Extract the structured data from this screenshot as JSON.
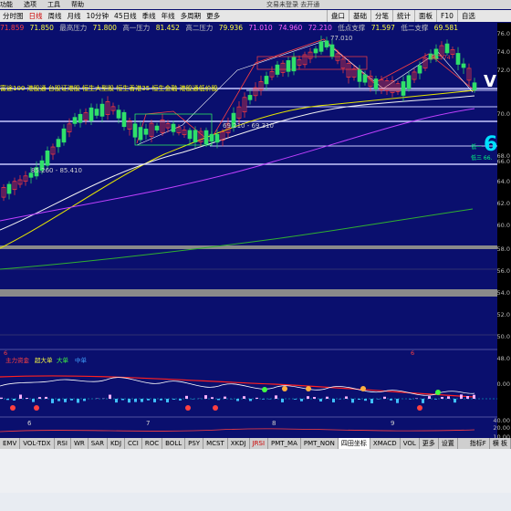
{
  "menubar": {
    "items": [
      "功能",
      "选项",
      "工具",
      "帮助"
    ],
    "center_text": "交易未登录 去开通"
  },
  "periods": [
    "分时图",
    "日线",
    "周线",
    "月线",
    "10分钟",
    "45日线",
    "季线",
    "年线",
    "多周期",
    "更多"
  ],
  "selected_period": "日线",
  "right_tools": [
    "盘口",
    "基础",
    "分笔",
    "统计",
    "面板",
    "F10",
    "自选"
  ],
  "info": {
    "prices": [
      "71.859",
      "71.850",
      "71.800",
      "81.452",
      "79.936",
      "71.010",
      "74.960",
      "72.210",
      "71.597",
      "69.581"
    ],
    "labels": [
      "最高压力",
      "高一压力",
      "高二压力",
      "低点支撑",
      "低二支撑"
    ]
  },
  "sector_text": "富途100 港股通 台股证港股 恒生大型股 恒生香港35 恒生金融 港股通低价股",
  "annotations": {
    "range1": "85.260 - 85.410",
    "range2": "69.210 - 69.310",
    "high_mark": "77.010",
    "big_price": "69",
    "v_mark": "V",
    "label_low1": "低一",
    "label_low3": "低三 66.",
    "label_high2": "高二 74"
  },
  "y_ticks": [
    "76.0",
    "74.0",
    "72.0",
    "70.0",
    "68.0",
    "66.0",
    "64.0",
    "62.0",
    "60.0",
    "58.0",
    "56.0",
    "54.0",
    "52.0",
    "50.0",
    "48.0",
    "46.0"
  ],
  "ind_ticks": [
    "0.00",
    "40.00",
    "20.00",
    "10.00"
  ],
  "date_ticks": [
    "6",
    "7",
    "8",
    "9"
  ],
  "indicator_legend": [
    "主力资金",
    "超大单",
    "大单",
    "中单"
  ],
  "tabs": [
    "EMV",
    "VOL-TDX",
    "RSI",
    "WR",
    "SAR",
    "KDJ",
    "CCI",
    "ROC",
    "BOLL",
    "PSY",
    "MCST",
    "XKDJ",
    "JRSI",
    "PMT_MA",
    "PMT_NON",
    "四田坐标",
    "XMACD",
    "VOL",
    "更多",
    "设置"
  ],
  "tab_selected": "四田坐标",
  "tab_red": "JRSI",
  "tab_right": [
    "指标F",
    "横 板"
  ],
  "colors": {
    "bg": "#0a0f6e",
    "up": "#ff3b3b",
    "down": "#2fe06a",
    "ma1": "#f2f2f2",
    "ma2": "#e6e600",
    "ma3": "#c040ff",
    "ma4": "#30b030",
    "accent": "#00ffff"
  }
}
